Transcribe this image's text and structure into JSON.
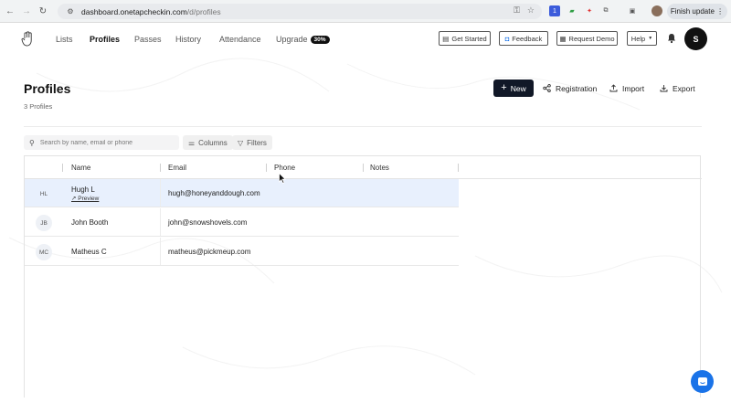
{
  "browser": {
    "url_host": "dashboard.onetapcheckin.com",
    "url_path": "/d/profiles",
    "finish_update": "Finish update",
    "ext_badge": "1"
  },
  "nav": {
    "items": [
      "Lists",
      "Profiles",
      "Passes",
      "History",
      "Attendance"
    ],
    "active": "Profiles",
    "upgrade_label": "Upgrade",
    "upgrade_badge": "30%"
  },
  "header_buttons": {
    "get_started": "Get Started",
    "feedback": "Feedback",
    "request_demo": "Request Demo",
    "help": "Help"
  },
  "user": {
    "initial": "S"
  },
  "page": {
    "title": "Profiles",
    "subtitle": "3 Profiles",
    "new_label": "New",
    "registration_label": "Registration",
    "import_label": "Import",
    "export_label": "Export"
  },
  "toolbar": {
    "search_placeholder": "Search by name, email or phone",
    "columns_label": "Columns",
    "filters_label": "Filters"
  },
  "table": {
    "headers": [
      "Name",
      "Email",
      "Phone",
      "Notes"
    ],
    "rows": [
      {
        "initials": "HL",
        "name": "Hugh L",
        "email": "hugh@honeyanddough.com",
        "preview": "↗ Preview",
        "selected": true
      },
      {
        "initials": "JB",
        "name": "John Booth",
        "email": "john@snowshovels.com"
      },
      {
        "initials": "MC",
        "name": "Matheus C",
        "email": "matheus@pickmeup.com"
      }
    ]
  },
  "colors": {
    "primary_button": "#111827",
    "selected_row": "#e8f0fd",
    "chat_button": "#1a73e8"
  }
}
